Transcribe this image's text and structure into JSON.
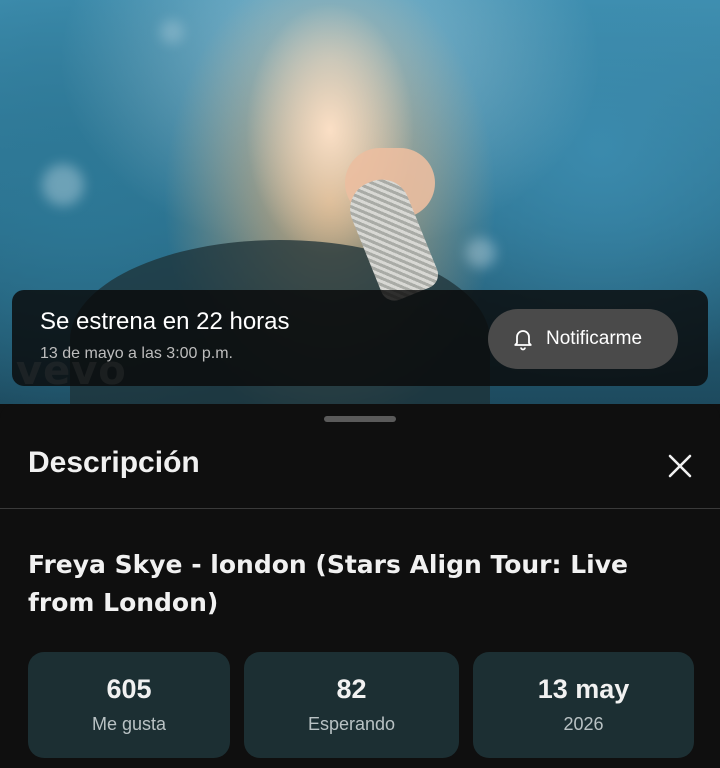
{
  "premiere": {
    "title": "Se estrena en 22 horas",
    "date": "13 de mayo a las 3:00 p.m.",
    "notify_label": "Notificarme",
    "watermark": "vevo"
  },
  "description_sheet": {
    "title": "Descripción",
    "video_title": "Freya Skye - london (Stars Align Tour: Live from London)",
    "stats": [
      {
        "value": "605",
        "label": "Me gusta"
      },
      {
        "value": "82",
        "label": "Esperando"
      },
      {
        "value": "13 may",
        "label": "2026"
      }
    ]
  },
  "icons": {
    "notify": "bell-icon",
    "close": "close-icon"
  },
  "colors": {
    "background": "#0f0f0f",
    "stat_card": "#1c2f33",
    "notify_button": "#4a4a4a"
  }
}
